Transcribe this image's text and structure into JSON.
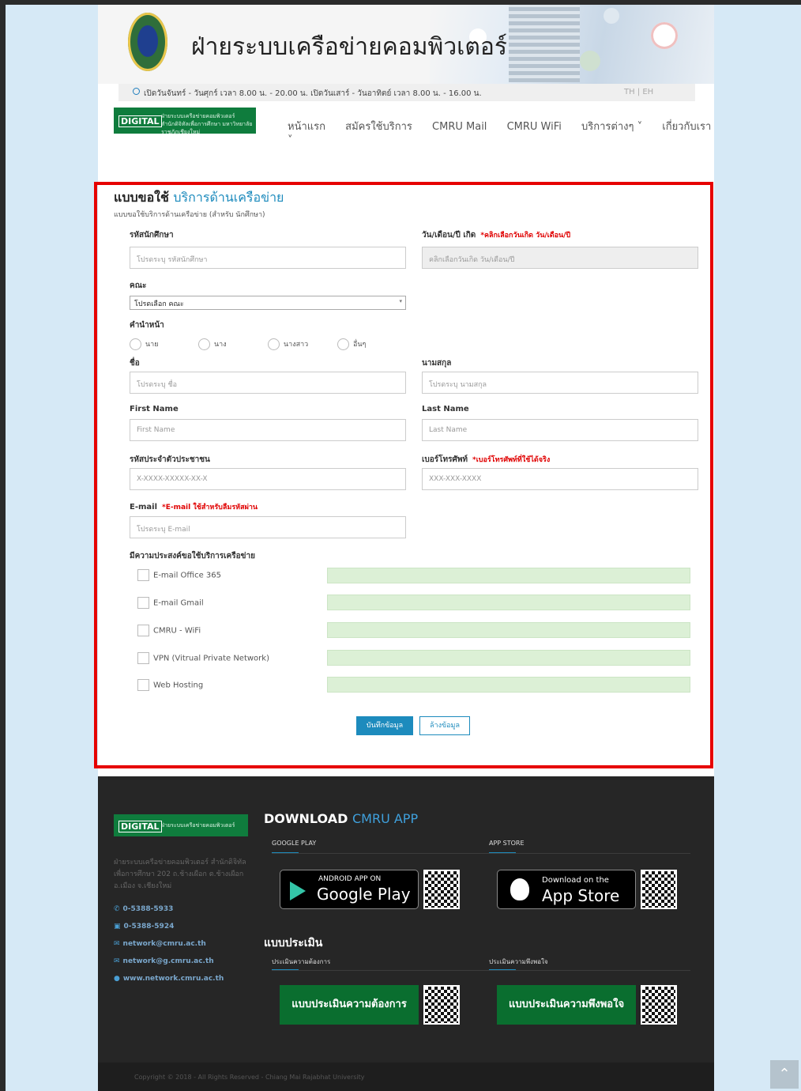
{
  "header": {
    "site_title": "ฝ่ายระบบเครือข่ายคอมพิวเตอร์",
    "hours": "เปิดวันจันทร์ - วันศุกร์ เวลา 8.00 น. - 20.00 น. เปิดวันเสาร์ - วันอาทิตย์ เวลา 8.00 น. - 16.00 น.",
    "lang": "TH | EH",
    "brand_digital": "DIGITAL",
    "brand_sub_1": "ฝ่ายระบบเครือข่ายคอมพิวเตอร์",
    "brand_sub_2": "สำนักดิจิทัลเพื่อการศึกษา มหาวิทยาลัยราชภัฏเชียงใหม่",
    "nav": [
      "หน้าแรก",
      "สมัครใช้บริการ",
      "CMRU Mail",
      "CMRU WiFi",
      "บริการต่างๆ ˅",
      "เกี่ยวกับเรา ˅"
    ]
  },
  "form": {
    "title_a": "แบบขอใช้",
    "title_b": "บริการด้านเครือข่าย",
    "subtitle": "แบบขอใช้บริการด้านเครือข่าย (สำหรับ นักศึกษา)",
    "student_id_label": "รหัสนักศึกษา",
    "student_id_placeholder": "โปรดระบุ รหัสนักศึกษา",
    "dob_label": "วัน/เดือน/ปี เกิด",
    "dob_note": "*คลิกเลือกวันเกิด วัน/เดือน/ปี",
    "dob_placeholder": "คลิกเลือกวันเกิด วัน/เดือน/ปี",
    "faculty_label": "คณะ",
    "faculty_value": "โปรดเลือก คณะ",
    "prefix_label": "คำนำหน้า",
    "prefixes": [
      "นาย",
      "นาง",
      "นางสาว",
      "อื่นๆ"
    ],
    "first_th_label": "ชื่อ",
    "first_th_placeholder": "โปรดระบุ ชื่อ",
    "last_th_label": "นามสกุล",
    "last_th_placeholder": "โปรดระบุ นามสกุล",
    "first_en_label": "First Name",
    "first_en_placeholder": "First Name",
    "last_en_label": "Last Name",
    "last_en_placeholder": "Last Name",
    "citizen_label": "รหัสประจำตัวประชาชน",
    "citizen_placeholder": "X-XXXX-XXXXX-XX-X",
    "phone_label": "เบอร์โทรศัพท์",
    "phone_note": "*เบอร์โทรศัพท์ที่ใช้ได้จริง",
    "phone_placeholder": "XXX-XXX-XXXX",
    "email_label": "E-mail",
    "email_note": "*E-mail ใช้สำหรับลืมรหัสผ่าน",
    "email_placeholder": "โปรดระบุ E-mail",
    "services_label": "มีความประสงค์ขอใช้บริการเครือข่าย",
    "services": [
      "E-mail Office 365",
      "E-mail Gmail",
      "CMRU - WiFi",
      "VPN (Vitrual Private Network)",
      "Web Hosting"
    ],
    "save_button": "บันทึกข้อมูล",
    "clear_button": "ล้างข้อมูล"
  },
  "footer": {
    "brand_digital": "DIGITAL",
    "brand_sub": "ฝ่ายระบบเครือข่ายคอมพิวเตอร์",
    "address": "ฝ่ายระบบเครือข่ายคอมพิวเตอร์ สำนักดิจิทัลเพื่อการศึกษา 202 ถ.ช้างเผือก ต.ช้างเผือก อ.เมือง จ.เชียงใหม่",
    "phone": "0-5388-5933",
    "fax": "0-5388-5924",
    "email_1": "network@cmru.ac.th",
    "email_2": "network@g.cmru.ac.th",
    "web": "www.network.cmru.ac.th",
    "download_a": "DOWNLOAD",
    "download_b": "CMRU APP",
    "google_play_tag": "GOOGLE PLAY",
    "app_store_tag": "APP STORE",
    "android_line1": "ANDROID APP ON",
    "android_line2": "Google Play",
    "ios_line1": "Download on the",
    "ios_line2": "App Store",
    "eval_title": "แบบประเมิน",
    "eval_need_tag": "ประเมินความต้องการ",
    "eval_sat_tag": "ประเมินความพึงพอใจ",
    "eval_need_button": "แบบประเมินความต้องการ",
    "eval_sat_button": "แบบประเมินความพึงพอใจ",
    "copyright": "Copyright © 2018 - All Rights Reserved - Chiang Mai Rajabhat University"
  },
  "colors": {
    "accent": "#1d8bbd",
    "brand_green": "#0f7c3d",
    "required": "#e00000",
    "highlight_frame": "#e60000"
  },
  "icons": [
    "university-seal-icon",
    "clock-icon",
    "phone-icon",
    "fax-icon",
    "mail-icon",
    "globe-icon",
    "google-play-icon",
    "apple-icon",
    "qr-code-icon",
    "arrow-up-icon"
  ]
}
